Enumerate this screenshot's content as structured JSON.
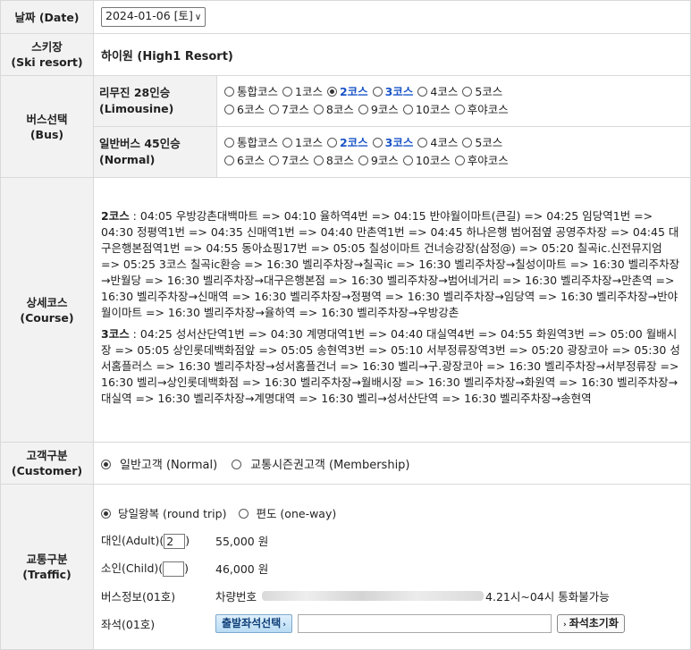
{
  "date": {
    "label_ko": "날짜",
    "label_en": "(Date)",
    "value": "2024-01-06 [토]"
  },
  "ski_resort": {
    "label_ko": "스키장",
    "label_en": "(Ski resort)",
    "value": "하이원 (High1 Resort)"
  },
  "bus": {
    "label_ko": "버스선택",
    "label_en": "(Bus)",
    "rows": [
      {
        "name_ko": "리무진 28인승",
        "name_en": "(Limousine)",
        "line1": [
          {
            "label": "통합코스",
            "checked": false,
            "highlight": false
          },
          {
            "label": "1코스",
            "checked": false,
            "highlight": false
          },
          {
            "label": "2코스",
            "checked": true,
            "highlight": true
          },
          {
            "label": "3코스",
            "checked": false,
            "highlight": true
          },
          {
            "label": "4코스",
            "checked": false,
            "highlight": false
          },
          {
            "label": "5코스",
            "checked": false,
            "highlight": false
          }
        ],
        "line2": [
          {
            "label": "6코스",
            "checked": false,
            "highlight": false
          },
          {
            "label": "7코스",
            "checked": false,
            "highlight": false
          },
          {
            "label": "8코스",
            "checked": false,
            "highlight": false
          },
          {
            "label": "9코스",
            "checked": false,
            "highlight": false
          },
          {
            "label": "10코스",
            "checked": false,
            "highlight": false
          },
          {
            "label": "후야코스",
            "checked": false,
            "highlight": false
          }
        ]
      },
      {
        "name_ko": "일반버스 45인승",
        "name_en": "(Normal)",
        "line1": [
          {
            "label": "통합코스",
            "checked": false,
            "highlight": false
          },
          {
            "label": "1코스",
            "checked": false,
            "highlight": false
          },
          {
            "label": "2코스",
            "checked": false,
            "highlight": true
          },
          {
            "label": "3코스",
            "checked": false,
            "highlight": true
          },
          {
            "label": "4코스",
            "checked": false,
            "highlight": false
          },
          {
            "label": "5코스",
            "checked": false,
            "highlight": false
          }
        ],
        "line2": [
          {
            "label": "6코스",
            "checked": false,
            "highlight": false
          },
          {
            "label": "7코스",
            "checked": false,
            "highlight": false
          },
          {
            "label": "8코스",
            "checked": false,
            "highlight": false
          },
          {
            "label": "9코스",
            "checked": false,
            "highlight": false
          },
          {
            "label": "10코스",
            "checked": false,
            "highlight": false
          },
          {
            "label": "후야코스",
            "checked": false,
            "highlight": false
          }
        ]
      }
    ]
  },
  "course": {
    "label_ko": "상세코스",
    "label_en": "(Course)",
    "c2_name": "2코스",
    "c2_text": " : 04:05 우방강촌대백마트 => 04:10 율하역4번 => 04:15 반야월이마트(큰길) => 04:25 임당역1번 => 04:30 정평역1번 => 04:35 신매역1번 => 04:40 만촌역1번 => 04:45 하나은행 범어점옆 공영주차장 => 04:45 대구은행본점역1번 => 04:55 동아쇼핑17번 => 05:05 칠성이마트 건너승강장(삼정@) => 05:20 칠곡ic.신전뮤지엄 => 05:25 3코스 칠곡ic환승 => 16:30 벨리주차장→칠곡ic => 16:30 벨리주차장→칠성이마트 => 16:30 벨리주차장→반월당 => 16:30 벨리주차장→대구은행본점 => 16:30 벨리주차장→범어네거리 => 16:30 벨리주차장→만촌역 => 16:30 벨리주차장→신매역 => 16:30 벨리주차장→정평역 => 16:30 벨리주차장→임당역 => 16:30 벨리주차장→반야월이마트 => 16:30 벨리주차장→율하역 => 16:30 벨리주차장→우방강촌",
    "c3_name": "3코스",
    "c3_text": " : 04:25 성서산단역1번 => 04:30 계명대역1번 => 04:40 대실역4번 => 04:55 화원역3번 => 05:00 월배시장 => 05:05 상인롯데백화점앞 => 05:05 송현역3번 => 05:10 서부정류장역3번 => 05:20 광장코아 => 05:30 성서홈플러스 => 16:30 벨리주차장→성서홈플건너 => 16:30 벨리→구.광장코아 => 16:30 벨리주차장→서부정류장 => 16:30 벨리→상인롯데백화점 => 16:30 벨리주차장→월배시장 => 16:30 벨리주차장→화원역 => 16:30 벨리주차장→대실역 => 16:30 벨리주차장→계명대역 => 16:30 벨리→성서산단역 => 16:30 벨리주차장→송현역"
  },
  "customer": {
    "label_ko": "고객구분",
    "label_en": "(Customer)",
    "options": [
      {
        "label": "일반고객 (Normal)",
        "checked": true
      },
      {
        "label": "교통시즌권고객 (Membership)",
        "checked": false
      }
    ]
  },
  "traffic": {
    "label_ko": "교통구분",
    "label_en": "(Traffic)",
    "trip_options": [
      {
        "label": "당일왕복 (round trip)",
        "checked": true
      },
      {
        "label": "편도 (one-way)",
        "checked": false
      }
    ],
    "adult": {
      "prefix": "대인(Adult)(",
      "qty": "2",
      "suffix": ")",
      "price": "55,000 원"
    },
    "child": {
      "prefix": "소인(Child)(",
      "qty": "",
      "suffix": ")",
      "price": "46,000 원"
    },
    "bus_info": {
      "label": "버스정보(01호)",
      "car_label": "차량번호",
      "note": "4.21시~04시 통화불가능"
    },
    "seat": {
      "label": "좌석(01호)",
      "select_button": "출발좌석선택",
      "reset_button": "좌석초기화"
    }
  }
}
